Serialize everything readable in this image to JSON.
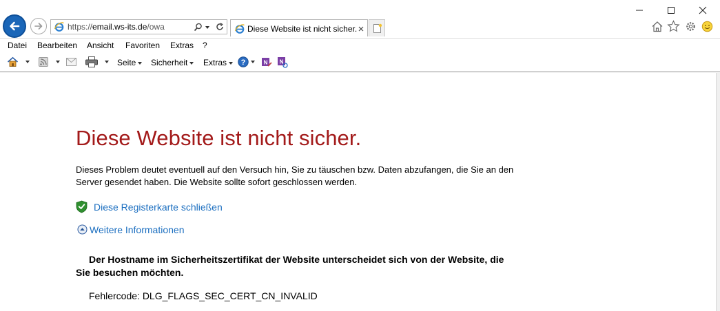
{
  "browser": {
    "address_url_prefix": "https://",
    "address_url_host": "email.ws-its.de",
    "address_url_path": "/owa",
    "tab_title": "Diese Website ist nicht sicher.",
    "window_controls": [
      "minimize-icon",
      "maximize-icon",
      "close-icon"
    ],
    "right_icons": [
      "home-icon",
      "favorites-star-icon",
      "gear-icon",
      "smiley-icon"
    ]
  },
  "menubar": {
    "items": [
      "Datei",
      "Bearbeiten",
      "Ansicht",
      "Favoriten",
      "Extras",
      "?"
    ]
  },
  "commandbar": {
    "page_label": "Seite",
    "security_label": "Sicherheit",
    "tools_label": "Extras",
    "icons": [
      "home-icon",
      "rss-feed-icon",
      "mail-icon",
      "print-icon",
      "help-icon",
      "onenote-icon",
      "onenote-linked-icon"
    ]
  },
  "content": {
    "title": "Diese Website ist nicht sicher.",
    "description": "Dieses Problem deutet eventuell auf den Versuch hin, Sie zu täuschen bzw. Daten abzufangen, die Sie an den Server gesendet haben. Die Website sollte sofort geschlossen werden.",
    "close_tab_link": "Diese Registerkarte schließen",
    "more_info_link": "Weitere Informationen",
    "host_message": "Der Hostname im Sicherheitszertifikat der Website unterscheidet sich von der Website, die Sie besuchen möchten.",
    "error_code": "Fehlercode: DLG_FLAGS_SEC_CERT_CN_INVALID"
  },
  "colors": {
    "title_red": "#a31a1a",
    "link_blue": "#1c6fc0",
    "back_button_blue": "#1a66b8",
    "shield_green": "#2f8f2f"
  }
}
